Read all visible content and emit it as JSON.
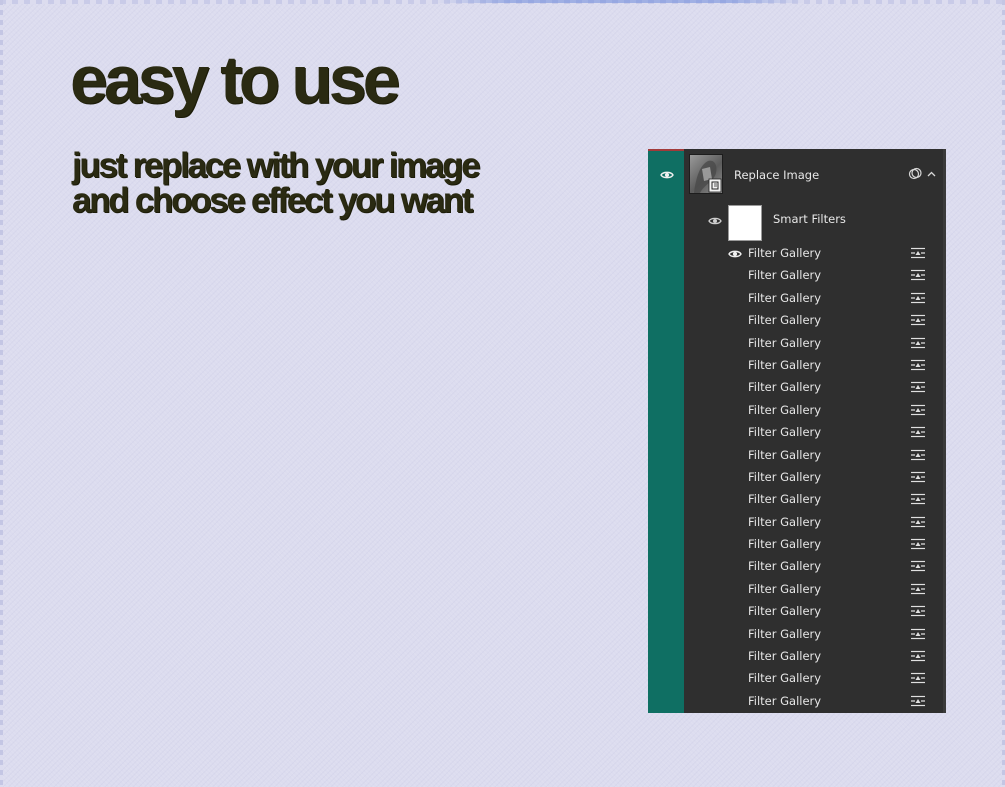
{
  "headline": "easy to use",
  "subline": {
    "line1": "just replace with your image",
    "line2": "and choose effect you want"
  },
  "layers_panel": {
    "layer": {
      "name": "Replace Image",
      "visible": true,
      "thumbnail_icon": "smart-object-thumbnail"
    },
    "smart_filters": {
      "label": "Smart Filters",
      "visible": true,
      "mask_color": "#ffffff"
    },
    "filters": [
      {
        "label": "Filter Gallery",
        "visible": true
      },
      {
        "label": "Filter Gallery"
      },
      {
        "label": "Filter Gallery"
      },
      {
        "label": "Filter Gallery"
      },
      {
        "label": "Filter Gallery"
      },
      {
        "label": "Filter Gallery"
      },
      {
        "label": "Filter Gallery"
      },
      {
        "label": "Filter Gallery"
      },
      {
        "label": "Filter Gallery"
      },
      {
        "label": "Filter Gallery"
      },
      {
        "label": "Filter Gallery"
      },
      {
        "label": "Filter Gallery"
      },
      {
        "label": "Filter Gallery"
      },
      {
        "label": "Filter Gallery"
      },
      {
        "label": "Filter Gallery"
      },
      {
        "label": "Filter Gallery"
      },
      {
        "label": "Filter Gallery"
      },
      {
        "label": "Filter Gallery"
      },
      {
        "label": "Filter Gallery"
      },
      {
        "label": "Filter Gallery"
      },
      {
        "label": "Filter Gallery"
      }
    ],
    "colors": {
      "panel_bg": "#2f2f2f",
      "selection_strip": "#0f6f63",
      "text": "#e6e6e6"
    },
    "icons": {
      "visibility": "eye-icon",
      "blending_options": "blending-options-icon",
      "smart_object_badge": "smart-object-icon",
      "collapse": "chevron-up-icon"
    }
  }
}
